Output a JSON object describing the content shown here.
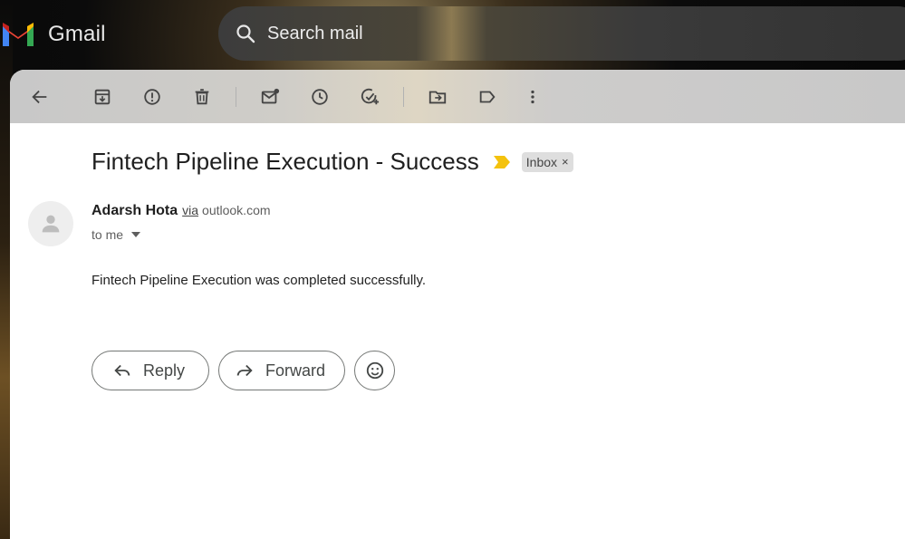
{
  "app": {
    "name": "Gmail"
  },
  "search": {
    "placeholder": "Search mail"
  },
  "toolbar": {
    "icons": [
      "back-arrow-icon",
      "archive-icon",
      "report-spam-icon",
      "delete-icon",
      "mark-unread-icon",
      "snooze-icon",
      "add-task-icon",
      "move-to-icon",
      "label-icon",
      "more-vert-icon"
    ]
  },
  "email": {
    "subject": "Fintech Pipeline Execution - Success",
    "label": "Inbox",
    "label_remove": "×",
    "sender_name": "Adarsh Hota",
    "via": "via",
    "sender_domain": "outlook.com",
    "to": "to me",
    "body": "Fintech Pipeline Execution was completed successfully."
  },
  "actions": {
    "reply": "Reply",
    "forward": "Forward"
  },
  "colors": {
    "importance_marker": "#f4c20d",
    "toolbar_bg": "#c9c9c9",
    "panel_bg": "#ffffff"
  }
}
